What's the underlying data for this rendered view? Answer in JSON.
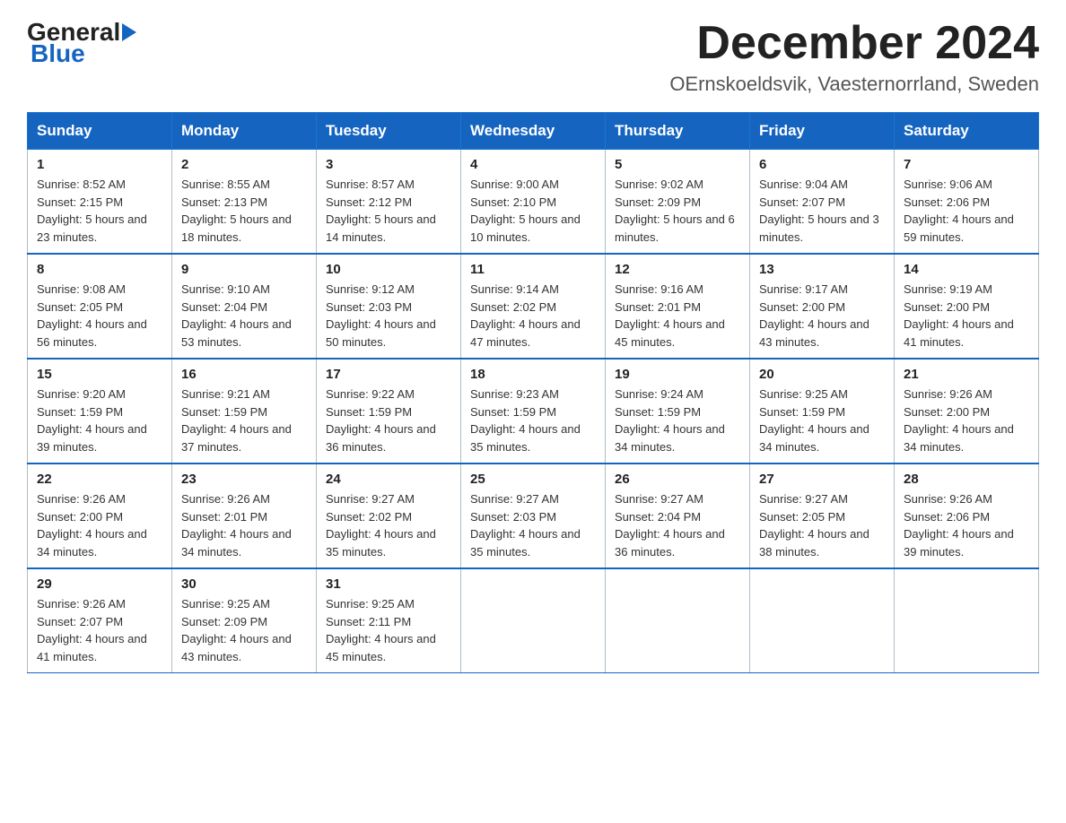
{
  "logo": {
    "general": "General",
    "blue": "Blue"
  },
  "title": "December 2024",
  "location": "OErnskoeldsvik, Vaesternorrland, Sweden",
  "weekdays": [
    "Sunday",
    "Monday",
    "Tuesday",
    "Wednesday",
    "Thursday",
    "Friday",
    "Saturday"
  ],
  "weeks": [
    [
      {
        "day": "1",
        "sunrise": "Sunrise: 8:52 AM",
        "sunset": "Sunset: 2:15 PM",
        "daylight": "Daylight: 5 hours and 23 minutes."
      },
      {
        "day": "2",
        "sunrise": "Sunrise: 8:55 AM",
        "sunset": "Sunset: 2:13 PM",
        "daylight": "Daylight: 5 hours and 18 minutes."
      },
      {
        "day": "3",
        "sunrise": "Sunrise: 8:57 AM",
        "sunset": "Sunset: 2:12 PM",
        "daylight": "Daylight: 5 hours and 14 minutes."
      },
      {
        "day": "4",
        "sunrise": "Sunrise: 9:00 AM",
        "sunset": "Sunset: 2:10 PM",
        "daylight": "Daylight: 5 hours and 10 minutes."
      },
      {
        "day": "5",
        "sunrise": "Sunrise: 9:02 AM",
        "sunset": "Sunset: 2:09 PM",
        "daylight": "Daylight: 5 hours and 6 minutes."
      },
      {
        "day": "6",
        "sunrise": "Sunrise: 9:04 AM",
        "sunset": "Sunset: 2:07 PM",
        "daylight": "Daylight: 5 hours and 3 minutes."
      },
      {
        "day": "7",
        "sunrise": "Sunrise: 9:06 AM",
        "sunset": "Sunset: 2:06 PM",
        "daylight": "Daylight: 4 hours and 59 minutes."
      }
    ],
    [
      {
        "day": "8",
        "sunrise": "Sunrise: 9:08 AM",
        "sunset": "Sunset: 2:05 PM",
        "daylight": "Daylight: 4 hours and 56 minutes."
      },
      {
        "day": "9",
        "sunrise": "Sunrise: 9:10 AM",
        "sunset": "Sunset: 2:04 PM",
        "daylight": "Daylight: 4 hours and 53 minutes."
      },
      {
        "day": "10",
        "sunrise": "Sunrise: 9:12 AM",
        "sunset": "Sunset: 2:03 PM",
        "daylight": "Daylight: 4 hours and 50 minutes."
      },
      {
        "day": "11",
        "sunrise": "Sunrise: 9:14 AM",
        "sunset": "Sunset: 2:02 PM",
        "daylight": "Daylight: 4 hours and 47 minutes."
      },
      {
        "day": "12",
        "sunrise": "Sunrise: 9:16 AM",
        "sunset": "Sunset: 2:01 PM",
        "daylight": "Daylight: 4 hours and 45 minutes."
      },
      {
        "day": "13",
        "sunrise": "Sunrise: 9:17 AM",
        "sunset": "Sunset: 2:00 PM",
        "daylight": "Daylight: 4 hours and 43 minutes."
      },
      {
        "day": "14",
        "sunrise": "Sunrise: 9:19 AM",
        "sunset": "Sunset: 2:00 PM",
        "daylight": "Daylight: 4 hours and 41 minutes."
      }
    ],
    [
      {
        "day": "15",
        "sunrise": "Sunrise: 9:20 AM",
        "sunset": "Sunset: 1:59 PM",
        "daylight": "Daylight: 4 hours and 39 minutes."
      },
      {
        "day": "16",
        "sunrise": "Sunrise: 9:21 AM",
        "sunset": "Sunset: 1:59 PM",
        "daylight": "Daylight: 4 hours and 37 minutes."
      },
      {
        "day": "17",
        "sunrise": "Sunrise: 9:22 AM",
        "sunset": "Sunset: 1:59 PM",
        "daylight": "Daylight: 4 hours and 36 minutes."
      },
      {
        "day": "18",
        "sunrise": "Sunrise: 9:23 AM",
        "sunset": "Sunset: 1:59 PM",
        "daylight": "Daylight: 4 hours and 35 minutes."
      },
      {
        "day": "19",
        "sunrise": "Sunrise: 9:24 AM",
        "sunset": "Sunset: 1:59 PM",
        "daylight": "Daylight: 4 hours and 34 minutes."
      },
      {
        "day": "20",
        "sunrise": "Sunrise: 9:25 AM",
        "sunset": "Sunset: 1:59 PM",
        "daylight": "Daylight: 4 hours and 34 minutes."
      },
      {
        "day": "21",
        "sunrise": "Sunrise: 9:26 AM",
        "sunset": "Sunset: 2:00 PM",
        "daylight": "Daylight: 4 hours and 34 minutes."
      }
    ],
    [
      {
        "day": "22",
        "sunrise": "Sunrise: 9:26 AM",
        "sunset": "Sunset: 2:00 PM",
        "daylight": "Daylight: 4 hours and 34 minutes."
      },
      {
        "day": "23",
        "sunrise": "Sunrise: 9:26 AM",
        "sunset": "Sunset: 2:01 PM",
        "daylight": "Daylight: 4 hours and 34 minutes."
      },
      {
        "day": "24",
        "sunrise": "Sunrise: 9:27 AM",
        "sunset": "Sunset: 2:02 PM",
        "daylight": "Daylight: 4 hours and 35 minutes."
      },
      {
        "day": "25",
        "sunrise": "Sunrise: 9:27 AM",
        "sunset": "Sunset: 2:03 PM",
        "daylight": "Daylight: 4 hours and 35 minutes."
      },
      {
        "day": "26",
        "sunrise": "Sunrise: 9:27 AM",
        "sunset": "Sunset: 2:04 PM",
        "daylight": "Daylight: 4 hours and 36 minutes."
      },
      {
        "day": "27",
        "sunrise": "Sunrise: 9:27 AM",
        "sunset": "Sunset: 2:05 PM",
        "daylight": "Daylight: 4 hours and 38 minutes."
      },
      {
        "day": "28",
        "sunrise": "Sunrise: 9:26 AM",
        "sunset": "Sunset: 2:06 PM",
        "daylight": "Daylight: 4 hours and 39 minutes."
      }
    ],
    [
      {
        "day": "29",
        "sunrise": "Sunrise: 9:26 AM",
        "sunset": "Sunset: 2:07 PM",
        "daylight": "Daylight: 4 hours and 41 minutes."
      },
      {
        "day": "30",
        "sunrise": "Sunrise: 9:25 AM",
        "sunset": "Sunset: 2:09 PM",
        "daylight": "Daylight: 4 hours and 43 minutes."
      },
      {
        "day": "31",
        "sunrise": "Sunrise: 9:25 AM",
        "sunset": "Sunset: 2:11 PM",
        "daylight": "Daylight: 4 hours and 45 minutes."
      },
      null,
      null,
      null,
      null
    ]
  ]
}
